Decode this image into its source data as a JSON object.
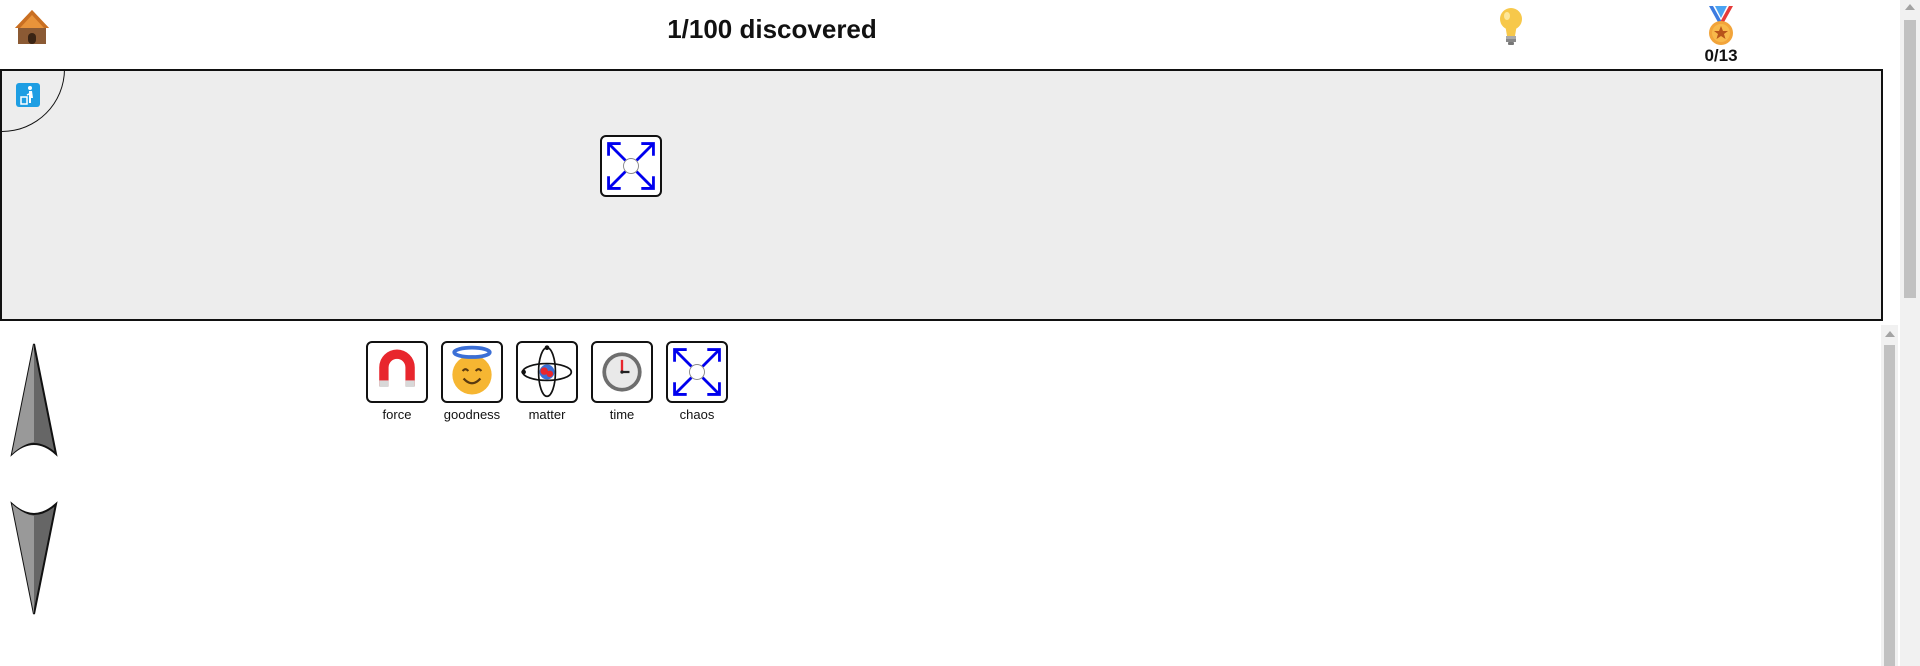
{
  "header": {
    "home_icon": "hut-icon",
    "discovered_text": "1/100 discovered",
    "hint_icon": "lightbulb-icon",
    "medal_icon": "medal-icon",
    "medal_count": "0/13"
  },
  "workspace": {
    "trash_icon": "trash-icon",
    "placed_elements": [
      {
        "name": "chaos",
        "icon": "chaos-arrows-icon"
      }
    ]
  },
  "tray": {
    "elements": [
      {
        "label": "force",
        "icon": "magnet-icon"
      },
      {
        "label": "goodness",
        "icon": "smiling-face-with-halo-icon"
      },
      {
        "label": "matter",
        "icon": "atom-icon"
      },
      {
        "label": "time",
        "icon": "clock-icon"
      },
      {
        "label": "chaos",
        "icon": "chaos-arrows-icon"
      }
    ],
    "scroll_up_icon": "arrow-up-icon",
    "scroll_down_icon": "arrow-down-icon"
  },
  "colors": {
    "workspace_bg": "#ededed",
    "chaos_blue": "#0000ee",
    "magnet_red": "#e8262d",
    "halo_blue": "#3b6fd6",
    "face_yellow": "#f6b632",
    "trash_blue": "#1e9ee3"
  }
}
